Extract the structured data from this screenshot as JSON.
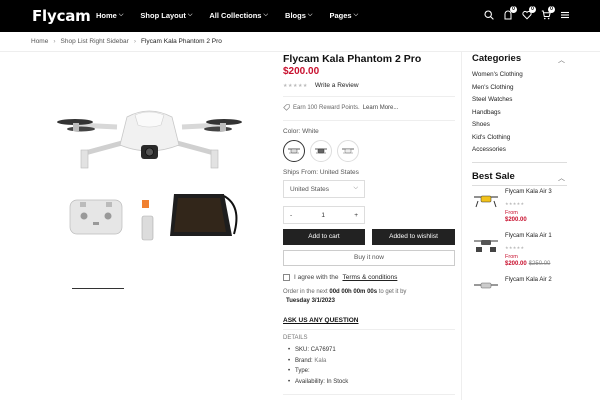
{
  "header": {
    "logo": "Flycam",
    "nav": [
      "Home",
      "Shop Layout",
      "All Collections",
      "Blogs",
      "Pages"
    ],
    "badges": {
      "account": "0",
      "wishlist": "0",
      "cart": "0"
    }
  },
  "breadcrumb": {
    "items": [
      "Home",
      "Shop List Right Sidebar"
    ],
    "current": "Flycam Kala Phantom 2 Pro"
  },
  "product": {
    "title": "Flycam Kala Phantom 2 Pro",
    "price": "$200.00",
    "review_link": "Write a Review",
    "reward": "Earn 100 Reward Points.",
    "reward_link": "Learn More...",
    "color_label": "Color: White",
    "ships_label": "Ships From: United States",
    "country": "United States",
    "qty_minus": "-",
    "qty": "1",
    "qty_plus": "+",
    "add_to_cart": "Add to cart",
    "add_to_wishlist": "Added to wishlist",
    "buy_now": "Buy it now",
    "terms_pre": "I agree with the",
    "terms_link": "Terms & conditions",
    "order_pre": "Order in the next",
    "countdown": "00d 00h 00m 00s",
    "order_post": "to get it by",
    "delivery_date": "Tuesday 3/1/2023",
    "ask": "ASK US ANY QUESTION",
    "details_heading": "DETAILS",
    "details": {
      "sku_label": "SKU:",
      "sku": "CA76971",
      "brand_label": "Brand:",
      "brand": "Kala",
      "type_label": "Type:",
      "availability_label": "Availability:",
      "availability": "In Stock"
    }
  },
  "sidebar": {
    "categories_title": "Categories",
    "categories": [
      "Women's Clothing",
      "Men's Clothing",
      "Steel Watches",
      "Handbags",
      "Shoes",
      "Kid's Clothing",
      "Accessories"
    ],
    "best_sale_title": "Best Sale",
    "best_sale": [
      {
        "name": "Flycam Kala Air 3",
        "from": "From",
        "price": "$200.00",
        "old": ""
      },
      {
        "name": "Flycam Kala Air 1",
        "from": "From",
        "price": "$200.00",
        "old": "$250.00"
      },
      {
        "name": "Flycam Kala Air 2",
        "from": "",
        "price": "",
        "old": ""
      }
    ]
  },
  "colors": {
    "accent_red": "#c8102e",
    "header_bg": "#000000",
    "button_bg": "#222222"
  }
}
